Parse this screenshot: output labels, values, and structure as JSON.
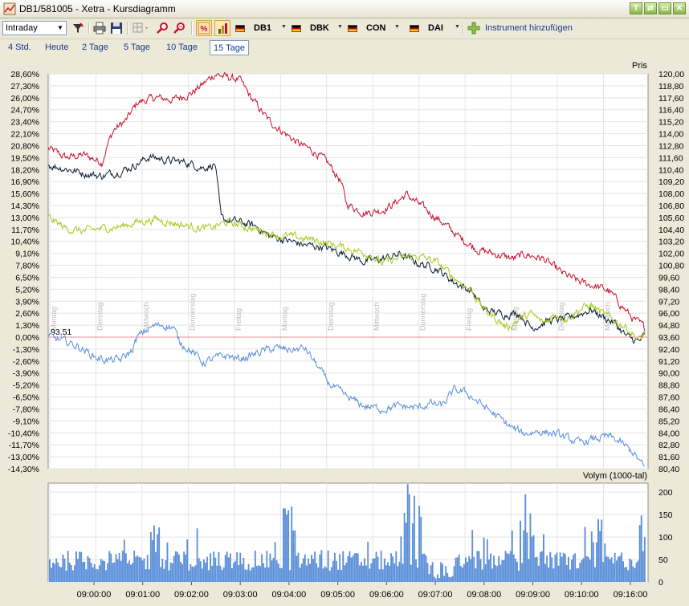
{
  "window": {
    "title": "DB1/581005 - Xetra - Kursdiagramm",
    "buttons": [
      "T",
      "⇄",
      "▭",
      "✕"
    ]
  },
  "toolbar": {
    "period_select": "Intraday",
    "instruments": [
      {
        "symbol": "DB1",
        "color": "#4a7fd4"
      },
      {
        "symbol": "DBK",
        "color": "#0b1f33"
      },
      {
        "symbol": "CON",
        "color": "#c8102e"
      },
      {
        "symbol": "DAI",
        "color": "#a8c81e"
      }
    ],
    "add_instrument_label": "Instrument hinzufügen"
  },
  "tabs": [
    {
      "label": "4 Std.",
      "active": false
    },
    {
      "label": "Heute",
      "active": false
    },
    {
      "label": "2 Tage",
      "active": false
    },
    {
      "label": "5 Tage",
      "active": false
    },
    {
      "label": "10 Tage",
      "active": false
    },
    {
      "label": "15 Tage",
      "active": true
    }
  ],
  "chart_data": [
    {
      "type": "line",
      "right_axis_title": "Pris",
      "left_ticks": [
        "28,60%",
        "27,30%",
        "26,00%",
        "24,70%",
        "23,40%",
        "22,10%",
        "20,80%",
        "19,50%",
        "18,20%",
        "16,90%",
        "15,60%",
        "14,30%",
        "13,00%",
        "11,70%",
        "10,40%",
        "9,10%",
        "7,80%",
        "6,50%",
        "5,20%",
        "3,90%",
        "2,60%",
        "1,30%",
        "0,00%",
        "-1,30%",
        "-2,60%",
        "-3,90%",
        "-5,20%",
        "-6,50%",
        "-7,80%",
        "-9,10%",
        "-10,40%",
        "-11,70%",
        "-13,00%",
        "-14,30%"
      ],
      "right_ticks": [
        "120,00",
        "118,80",
        "117,60",
        "116,40",
        "115,20",
        "114,00",
        "112,80",
        "111,60",
        "110,40",
        "109,20",
        "108,00",
        "106,80",
        "105,60",
        "104,40",
        "103,20",
        "102,00",
        "100,80",
        "99,60",
        "98,40",
        "97,20",
        "96,00",
        "94,80",
        "93,60",
        "92,40",
        "91,20",
        "90,00",
        "88,80",
        "87,60",
        "86,40",
        "85,20",
        "84,00",
        "82,80",
        "81,60",
        "80,40"
      ],
      "ylim_percent": [
        -14.3,
        28.6
      ],
      "reference_label": "93,51",
      "day_labels": [
        "Montag",
        "Dienstag",
        "Mittwoch",
        "Donnerstag",
        "Freitag",
        "Montag",
        "Dienstag",
        "Mittwoch",
        "Donnerstag",
        "Freitag",
        "Montag",
        "Dienstag",
        "Mittwoch"
      ],
      "series": [
        {
          "name": "CON",
          "color": "#c8102e",
          "keypoints": [
            [
              0,
              20.5
            ],
            [
              3,
              19.5
            ],
            [
              6,
              19.8
            ],
            [
              9,
              19
            ],
            [
              10,
              21
            ],
            [
              11,
              22.5
            ],
            [
              13,
              23.5
            ],
            [
              15,
              25.5
            ],
            [
              18,
              26
            ],
            [
              21,
              25.8
            ],
            [
              24,
              26.5
            ],
            [
              26,
              27.5
            ],
            [
              28,
              28.6
            ],
            [
              30,
              28.2
            ],
            [
              32,
              28
            ],
            [
              34,
              26
            ],
            [
              37,
              23.5
            ],
            [
              40,
              22
            ],
            [
              42,
              21
            ],
            [
              45,
              20
            ],
            [
              47,
              18.8
            ],
            [
              49,
              17
            ],
            [
              50,
              14.5
            ],
            [
              53,
              13.5
            ],
            [
              56,
              13.8
            ],
            [
              58,
              14.5
            ],
            [
              60,
              15.5
            ],
            [
              62,
              14.5
            ],
            [
              64,
              13.5
            ],
            [
              66,
              12.5
            ],
            [
              69,
              10.8
            ],
            [
              72,
              9.5
            ],
            [
              75,
              9
            ],
            [
              78,
              8.5
            ],
            [
              80,
              9
            ],
            [
              83,
              8.5
            ],
            [
              86,
              7
            ],
            [
              89,
              6
            ],
            [
              92,
              5.5
            ],
            [
              94,
              5
            ],
            [
              96,
              3.5
            ],
            [
              98,
              2
            ],
            [
              100,
              1
            ]
          ]
        },
        {
          "name": "DBK",
          "color": "#0b1f33",
          "keypoints": [
            [
              0,
              18.7
            ],
            [
              3,
              18.3
            ],
            [
              6,
              17.8
            ],
            [
              9,
              17.5
            ],
            [
              12,
              18
            ],
            [
              14,
              18.5
            ],
            [
              17,
              19.6
            ],
            [
              20,
              19.2
            ],
            [
              23,
              19
            ],
            [
              26,
              18.4
            ],
            [
              28,
              18.8
            ],
            [
              29,
              12.8
            ],
            [
              32,
              12.5
            ],
            [
              35,
              12
            ],
            [
              37,
              11
            ],
            [
              40,
              10.5
            ],
            [
              43,
              10
            ],
            [
              46,
              9.8
            ],
            [
              50,
              9
            ],
            [
              53,
              8.2
            ],
            [
              56,
              8.5
            ],
            [
              59,
              9
            ],
            [
              62,
              8
            ],
            [
              65,
              7.5
            ],
            [
              68,
              6
            ],
            [
              71,
              5
            ],
            [
              73,
              3
            ],
            [
              76,
              2.5
            ],
            [
              79,
              2.6
            ],
            [
              81,
              1
            ],
            [
              84,
              1.8
            ],
            [
              87,
              2
            ],
            [
              89,
              2.5
            ],
            [
              91,
              3
            ],
            [
              93,
              2.2
            ],
            [
              95,
              1.5
            ],
            [
              97,
              0
            ],
            [
              99,
              -0.5
            ],
            [
              100,
              0.2
            ]
          ]
        },
        {
          "name": "DAI",
          "color": "#a8c81e",
          "keypoints": [
            [
              0,
              13
            ],
            [
              3,
              11.8
            ],
            [
              6,
              11.5
            ],
            [
              9,
              11.8
            ],
            [
              12,
              12
            ],
            [
              15,
              12.5
            ],
            [
              18,
              12.8
            ],
            [
              21,
              12.4
            ],
            [
              24,
              12
            ],
            [
              27,
              11.8
            ],
            [
              30,
              12.5
            ],
            [
              33,
              12
            ],
            [
              36,
              11.5
            ],
            [
              39,
              11
            ],
            [
              42,
              10.8
            ],
            [
              45,
              10.5
            ],
            [
              48,
              10
            ],
            [
              51,
              9.5
            ],
            [
              54,
              9
            ],
            [
              56,
              8
            ],
            [
              59,
              8.6
            ],
            [
              62,
              8.8
            ],
            [
              65,
              8.2
            ],
            [
              68,
              6.5
            ],
            [
              71,
              5
            ],
            [
              73,
              3
            ],
            [
              75,
              2
            ],
            [
              77,
              1
            ],
            [
              79,
              2
            ],
            [
              81,
              2.5
            ],
            [
              83,
              1.5
            ],
            [
              85,
              2.5
            ],
            [
              87,
              2
            ],
            [
              89,
              3
            ],
            [
              91,
              3.5
            ],
            [
              93,
              2.5
            ],
            [
              95,
              1.8
            ],
            [
              97,
              1
            ],
            [
              99,
              -0.3
            ],
            [
              100,
              0.3
            ]
          ]
        },
        {
          "name": "DB1",
          "color": "#5b8fd9",
          "keypoints": [
            [
              0,
              0
            ],
            [
              3,
              -0.5
            ],
            [
              5,
              -1
            ],
            [
              8,
              -2.2
            ],
            [
              10,
              -2.5
            ],
            [
              12,
              -2.5
            ],
            [
              14,
              -1.5
            ],
            [
              15,
              0
            ],
            [
              17,
              1
            ],
            [
              19,
              1.4
            ],
            [
              21,
              1
            ],
            [
              22,
              -0.5
            ],
            [
              24,
              -1.5
            ],
            [
              26,
              -2.8
            ],
            [
              28,
              -2.3
            ],
            [
              30,
              -2
            ],
            [
              32,
              -2.4
            ],
            [
              34,
              -2
            ],
            [
              36,
              -1.5
            ],
            [
              38,
              -1.2
            ],
            [
              41,
              -1.4
            ],
            [
              43,
              -1.2
            ],
            [
              45,
              -3
            ],
            [
              47,
              -5
            ],
            [
              50,
              -6.5
            ],
            [
              53,
              -7.5
            ],
            [
              56,
              -7.8
            ],
            [
              59,
              -7.5
            ],
            [
              62,
              -7.7
            ],
            [
              64,
              -7.2
            ],
            [
              66,
              -7.5
            ],
            [
              68,
              -5.8
            ],
            [
              70,
              -6
            ],
            [
              72,
              -7
            ],
            [
              74,
              -8
            ],
            [
              76,
              -9
            ],
            [
              78,
              -10
            ],
            [
              80,
              -10.5
            ],
            [
              82,
              -10.2
            ],
            [
              85,
              -10.5
            ],
            [
              87,
              -11
            ],
            [
              89,
              -11.5
            ],
            [
              92,
              -11
            ],
            [
              94,
              -10.8
            ],
            [
              96,
              -11.5
            ],
            [
              98,
              -12.5
            ],
            [
              100,
              -14.3
            ]
          ]
        }
      ]
    },
    {
      "type": "bar",
      "ylabel": "Volym (1000-tal)",
      "y_ticks": [
        "200",
        "150",
        "100",
        "50",
        "0"
      ],
      "ylim": [
        0,
        220
      ],
      "x_ticks": [
        "09:00:00",
        "09:01:00",
        "09:02:00",
        "09:03:00",
        "09:04:00",
        "09:05:00",
        "09:06:00",
        "09:07:00",
        "09:08:00",
        "09:09:00",
        "09:10:00",
        "09:16:00"
      ],
      "bar_color": "#5b8fd9",
      "profile_peaks": [
        [
          18,
          150
        ],
        [
          40,
          170
        ],
        [
          60,
          210
        ],
        [
          63,
          200
        ],
        [
          66,
          150
        ],
        [
          80,
          160
        ],
        [
          92,
          140
        ],
        [
          100,
          150
        ]
      ]
    }
  ]
}
